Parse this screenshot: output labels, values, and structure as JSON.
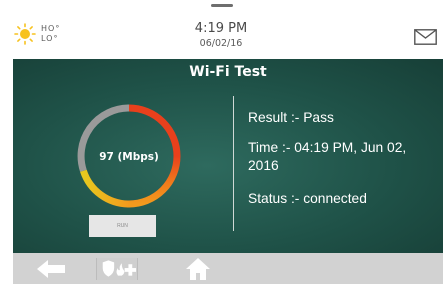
{
  "status_bar": {
    "weather": {
      "icon": "sun-icon",
      "high": "HO°",
      "low": "LO°"
    },
    "time": "4:19 PM",
    "date": "06/02/16",
    "mail_icon": "envelope-icon"
  },
  "wifi_test": {
    "title": "Wi-Fi Test",
    "speed_label": "97 (Mbps)",
    "run_label": "RUN",
    "result_text": "Result :- Pass",
    "time_text": "Time :- 04:19 PM, Jun 02, 2016",
    "status_text": "Status :- connected"
  },
  "nav": {
    "items": [
      {
        "name": "back",
        "icon": "back-arrow-icon"
      },
      {
        "name": "security",
        "icon": "shield-fire-medical-icon"
      },
      {
        "name": "home",
        "icon": "home-icon"
      }
    ]
  },
  "colors": {
    "panel": "#1f5248",
    "gauge_red": "#e8401c",
    "gauge_orange": "#f39a1d",
    "gauge_yellow": "#e6c91f",
    "gauge_gray": "#9a9a9a",
    "nav_bar": "#d2d2d2"
  }
}
